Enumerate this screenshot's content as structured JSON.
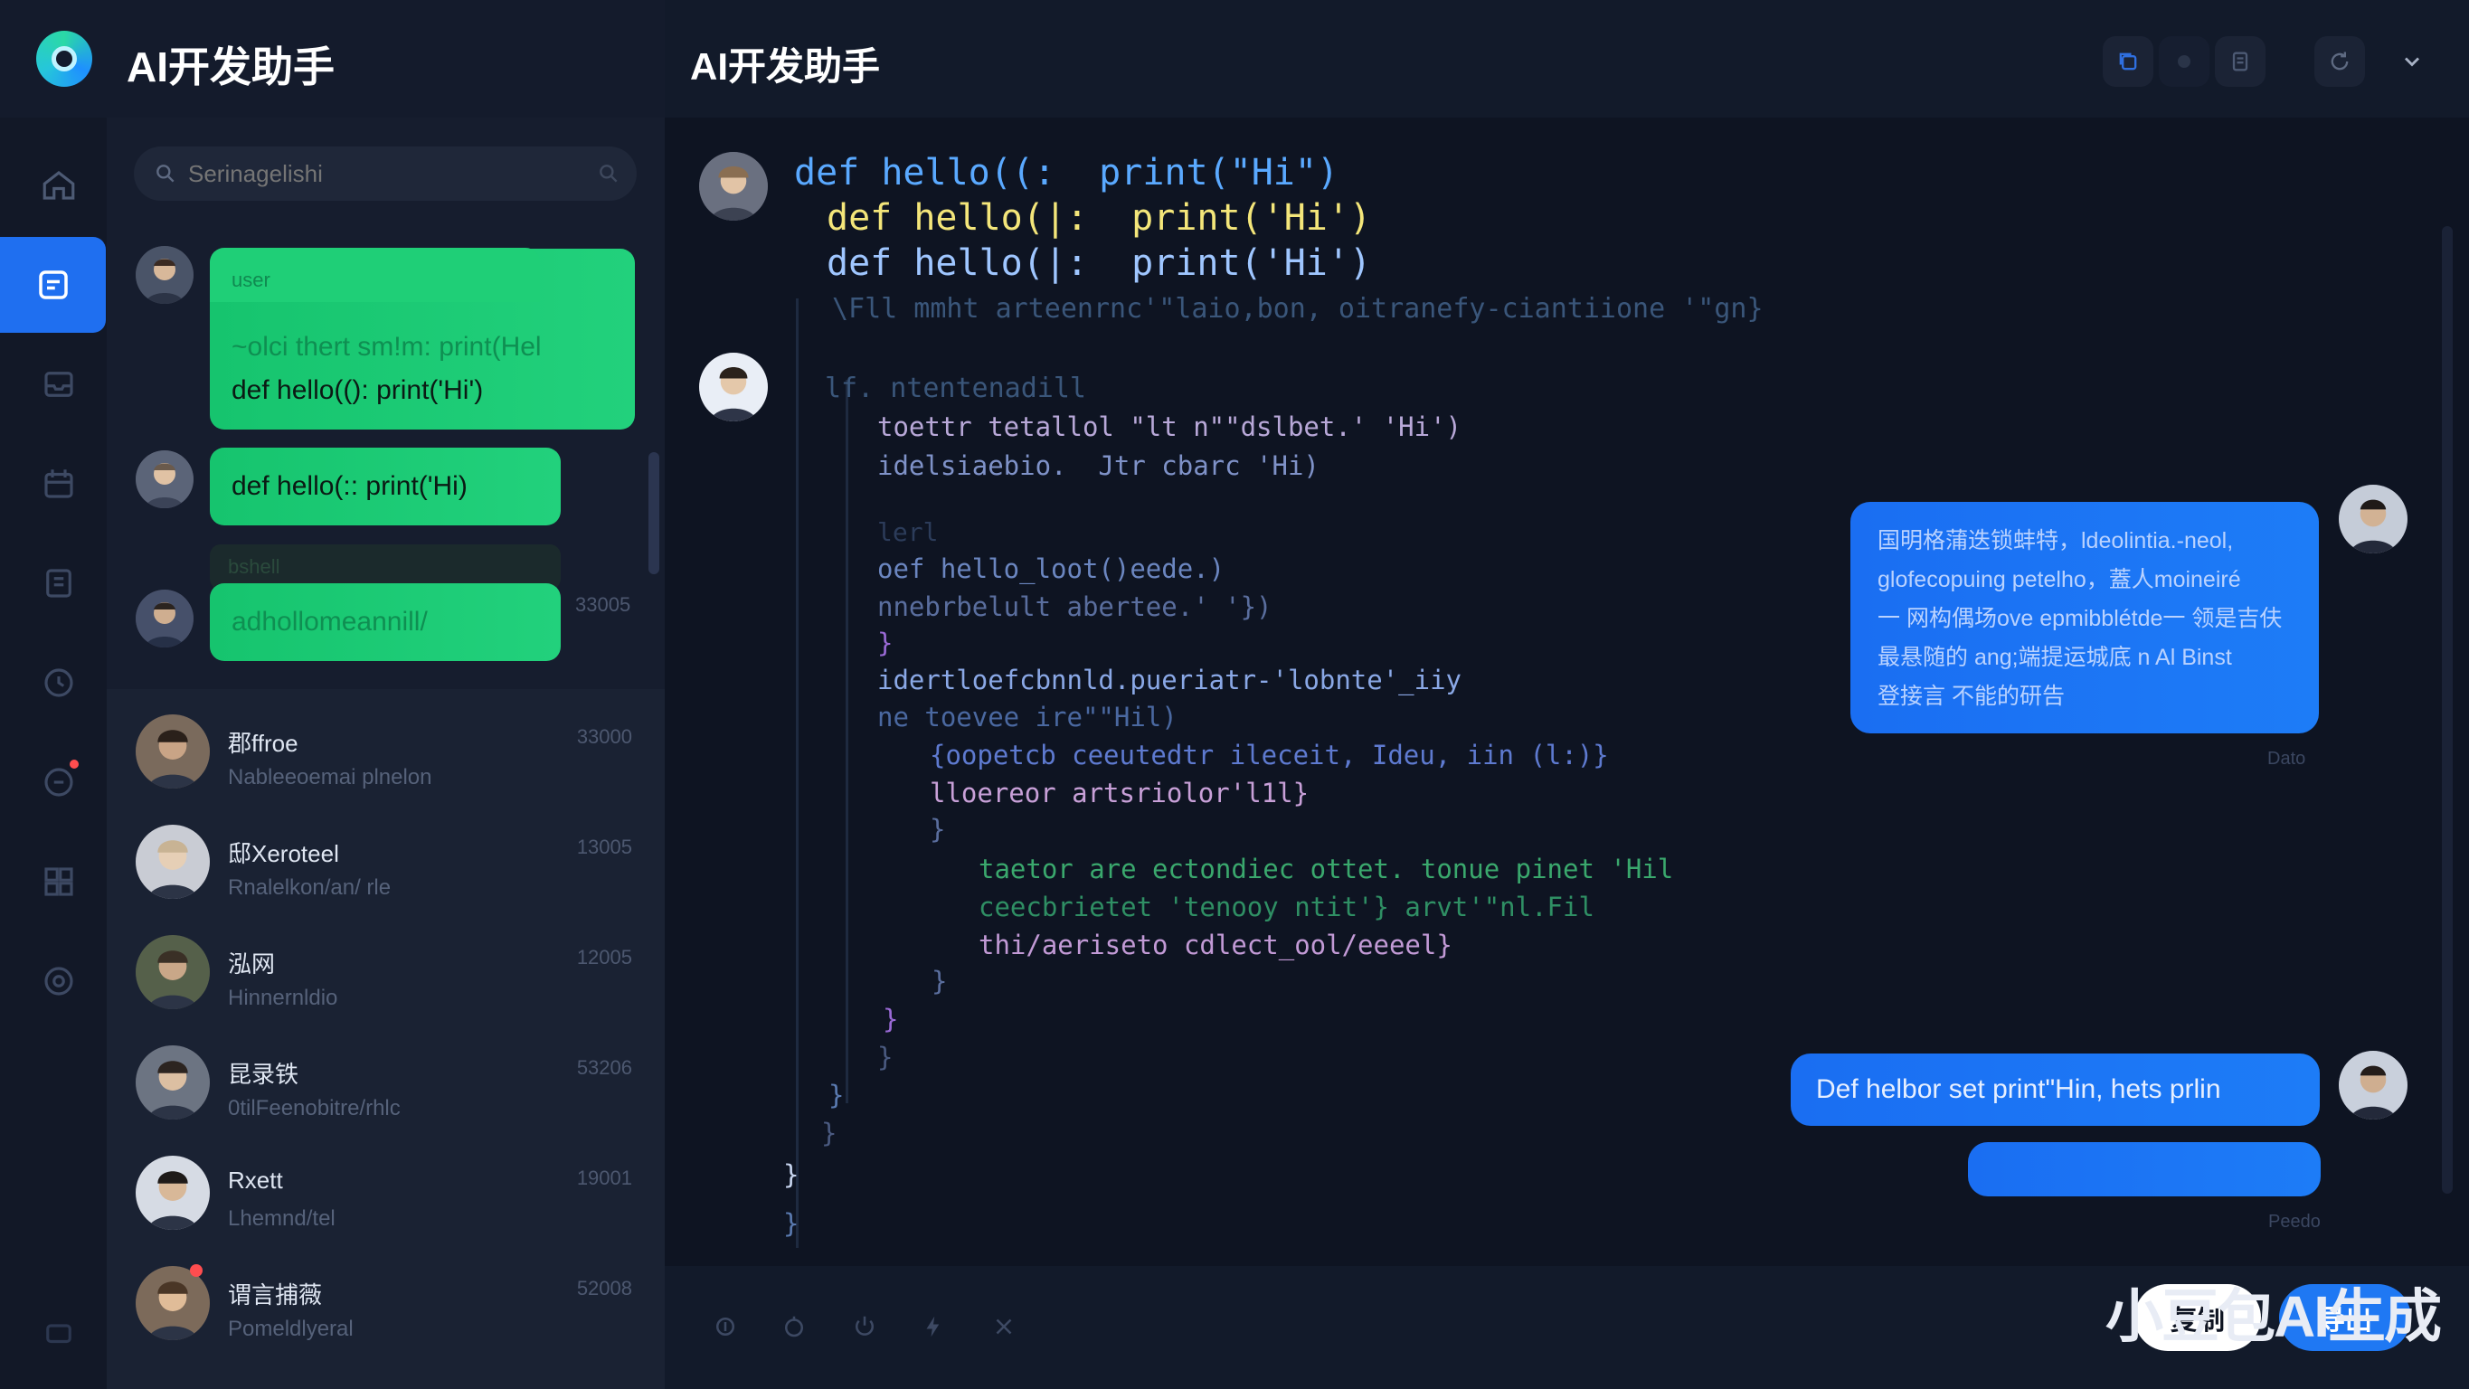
{
  "app": {
    "brand_title": "AI开发助手"
  },
  "main": {
    "title": "AI开发助手"
  },
  "search": {
    "placeholder": "Serinagelishi"
  },
  "colors": {
    "accent_blue": "#1f6ff0",
    "bubble_green": "#1fcf77",
    "bubble_blue": "#1a6ef2",
    "background": "#0f1524"
  },
  "rail": {
    "icons": [
      "home-icon",
      "chat-icon",
      "inbox-icon",
      "calendar-icon",
      "document-icon",
      "history-icon",
      "notification-icon",
      "grid-icon",
      "settings-icon",
      "account-icon"
    ]
  },
  "left_chat": {
    "msg1": {
      "header": "user",
      "line1": "~olci thert sm!m: print(Hel",
      "line2": "def hello(():  print('Hi')"
    },
    "msg2": {
      "text": "def hello(:: print('Hi)"
    },
    "msg3_ghost": "bshell",
    "msg3": {
      "text": "adhollomeannill/",
      "time": "33005"
    }
  },
  "contacts": [
    {
      "name": "郡ffroe",
      "sub": "Nableeoemai plnelon",
      "time": "33000"
    },
    {
      "name": "邸Xeroteel",
      "sub": "Rnalelkon/an/ rle",
      "time": "13005"
    },
    {
      "name": "泓网",
      "sub": "Hinnernldio",
      "time": "12005"
    },
    {
      "name": "昆录铁",
      "sub": "0tilFeenobitre/rhlc",
      "time": "53206"
    },
    {
      "name": "Rxett",
      "sub": "Lhemnd/tel",
      "time": "19001"
    },
    {
      "name": "谓言捕薇",
      "sub": "Pomeldlyeral",
      "time": "52008"
    }
  ],
  "code_block_1": {
    "l1": "def hello((:  print(\"Hi\")",
    "l2": "def hello(|:  print('Hi')",
    "l3": "def hello(|:  print('Hi')",
    "l4": "\\Fll mmht arteenrnc'\"laio,bon, oitranefy-ciantiione '\"gn}"
  },
  "code_block_2": {
    "l1": "lf. ntentenadill",
    "l2": "toettr tetallol \"lt n\"\"dslbet.' 'Hi')",
    "l3": "idelsiaebio.  Jtr cbarc 'Hi)",
    "l4": "lerl",
    "l5": "oef hello_loot()eede.)",
    "l6": "nnebrbelult abertee.' '})",
    "l7": "}",
    "l8": "idertloefcbnnld.pueriatr-'lobnte'_iiy",
    "l9": "ne toevee ire\"\"Hil)",
    "l10": "{oopetcb ceeutedtr ileceit, Ideu, iin (l:)}",
    "l11": "lloereor artsriolor'l1l}",
    "l12": "}",
    "l13": "taetor are ectondiec ottet. tonue pinet 'Hil",
    "l14": "ceecbrietet 'tenooy ntit'} arvt'\"nl.Fil",
    "l15": "thi/aeriseto cdlect_ool/eeeel}",
    "l16": "}",
    "l17": "}",
    "l18": "}",
    "l19": "}",
    "l20": "}",
    "l21": "}",
    "l22": "}"
  },
  "right_chat": {
    "msg1": {
      "lines": [
        "国明格蒲迭锁蚌特，ldeolintia.-neol,",
        "glofecopuing petelho，蓋人moineiré",
        "一 网构偶场ove epmibblétde一 领是吉伕",
        "最悬随的 ang;端提运城底 n Al Binst",
        "登接言 不能的研告"
      ],
      "time": "Dato"
    },
    "msg2": {
      "text": "Def helbor set print\"Hin, hets prlin",
      "time": "Peedo"
    }
  },
  "composer": {
    "tools": [
      "attach-icon",
      "emoji-icon",
      "power-icon",
      "lightning-icon",
      "scissors-icon"
    ],
    "watermark": "小豆包AI生成",
    "copy_label": "复制",
    "send_label": "导出"
  }
}
